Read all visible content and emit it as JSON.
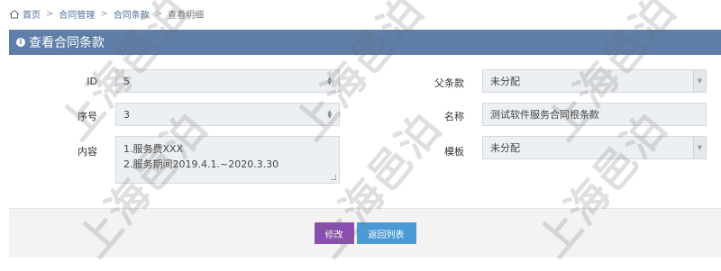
{
  "breadcrumb": {
    "home": "首页",
    "items": [
      "合同管理",
      "合同条款",
      "查看明细"
    ],
    "separator": ">"
  },
  "header": {
    "title": "查看合同条款"
  },
  "form": {
    "id": {
      "label": "ID",
      "value": "5"
    },
    "seq": {
      "label": "序号",
      "value": "3"
    },
    "content": {
      "label": "内容",
      "lines": [
        "1.服务费XXX",
        "2.服务期间2019.4.1.~2020.3.30"
      ]
    },
    "parent": {
      "label": "父条款",
      "value": "未分配"
    },
    "name": {
      "label": "名称",
      "value": "测试软件服务合同根条款"
    },
    "template": {
      "label": "模板",
      "value": "未分配"
    }
  },
  "buttons": {
    "edit": "修改",
    "back": "返回列表"
  },
  "watermark": "上海邑泊",
  "colors": {
    "header": "#5f7ea8",
    "edit": "#8a4fb0",
    "back": "#4a9ad6"
  }
}
